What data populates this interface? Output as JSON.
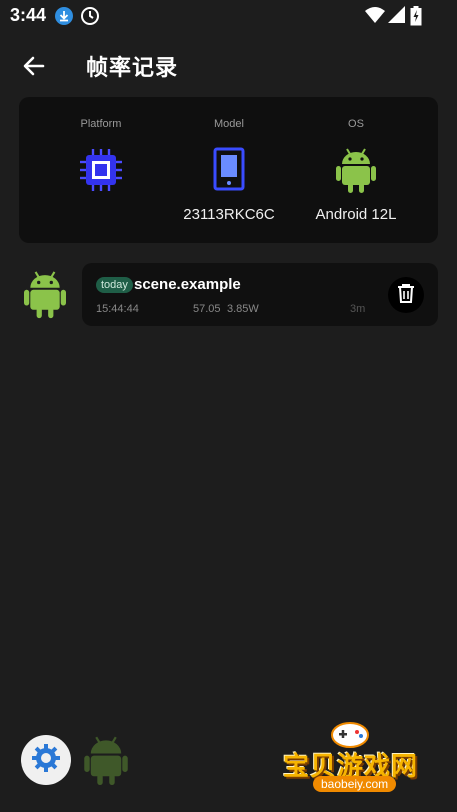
{
  "status_bar": {
    "time": "3:44",
    "icons": [
      "download-icon",
      "clock-icon",
      "wifi-icon",
      "signal-icon",
      "battery-icon"
    ]
  },
  "app_bar": {
    "back_icon": "arrow-left-icon",
    "title": "帧率记录"
  },
  "device_info": {
    "platform": {
      "label": "Platform",
      "icon": "cpu-chip-icon",
      "value": ""
    },
    "model": {
      "label": "Model",
      "icon": "phone-icon",
      "value": "23113RKC6C"
    },
    "os": {
      "label": "OS",
      "icon": "android-icon",
      "value": "Android 12L"
    }
  },
  "records": [
    {
      "icon": "android-icon",
      "badge": "today",
      "scene": "scene.example",
      "time": "15:44:44",
      "fps": "57.05",
      "power": "3.85W",
      "duration": "3m",
      "delete_icon": "trash-icon"
    }
  ],
  "bottom": {
    "settings_icon": "gear-icon",
    "android_icon": "android-icon"
  },
  "watermark": {
    "title": "宝贝游戏网",
    "url": "baobeiy.com"
  },
  "colors": {
    "background": "#1d1d1d",
    "card": "#0f0f0f",
    "accent_blue": "#3b3bff",
    "android_green": "#8bc34a",
    "badge": "#1f5e47"
  }
}
